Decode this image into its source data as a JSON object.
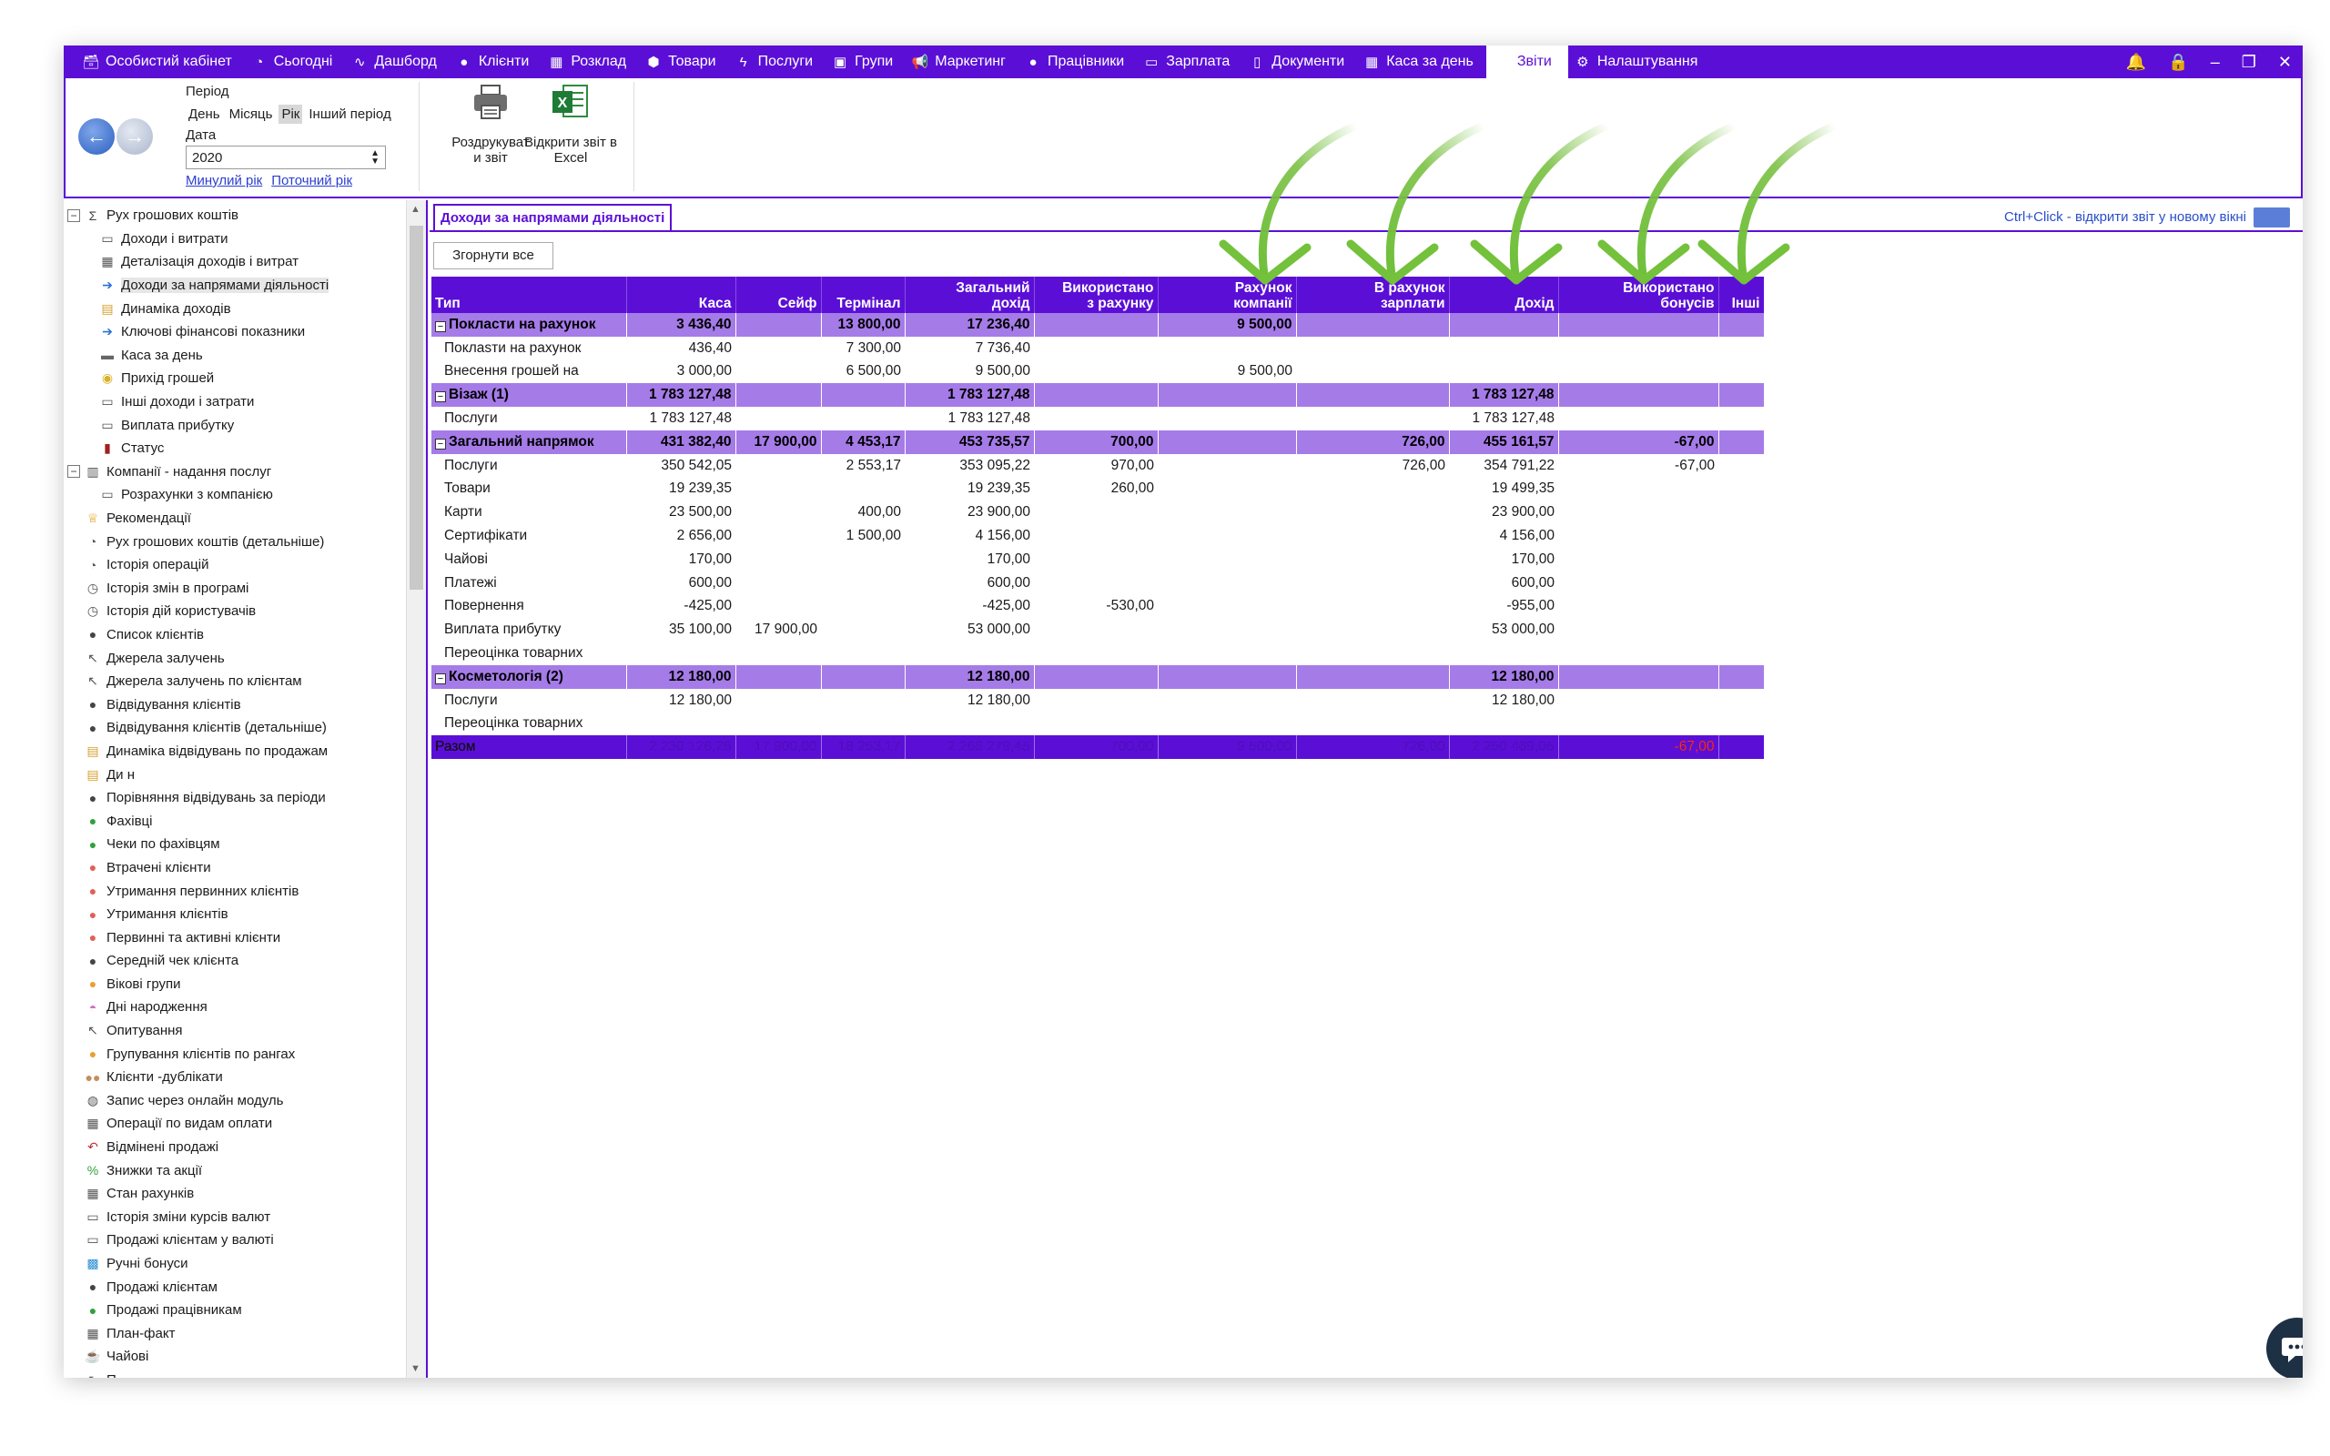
{
  "nav": {
    "items": [
      {
        "label": "Особистий кабінет",
        "icon": "cabinet-icon"
      },
      {
        "label": "Сьогодні",
        "icon": "clock-icon"
      },
      {
        "label": "Дашборд",
        "icon": "pulse-icon"
      },
      {
        "label": "Клієнти",
        "icon": "user-icon"
      },
      {
        "label": "Розклад",
        "icon": "calendar-icon"
      },
      {
        "label": "Товари",
        "icon": "box-icon"
      },
      {
        "label": "Послуги",
        "icon": "lightning-icon"
      },
      {
        "label": "Групи",
        "icon": "group-icon"
      },
      {
        "label": "Маркетинг",
        "icon": "megaphone-icon"
      },
      {
        "label": "Працівники",
        "icon": "worker-icon"
      },
      {
        "label": "Зарплата",
        "icon": "money-icon"
      },
      {
        "label": "Документи",
        "icon": "document-icon"
      },
      {
        "label": "Каса за день",
        "icon": "calculator-icon"
      },
      {
        "label": "Звіти",
        "icon": ""
      },
      {
        "label": "Налаштування",
        "icon": "gear-icon"
      }
    ],
    "active_index": 13
  },
  "ribbon": {
    "period_label": "Період",
    "period_tabs": [
      "День",
      "Місяць",
      "Рік",
      "Інший період"
    ],
    "period_selected": "Рік",
    "date_label": "Дата",
    "year_value": "2020",
    "prev_year_link": "Минулий рік",
    "current_year_link": "Поточний рік",
    "print_label": "Роздрукуват\nи звіт",
    "excel_label": "Відкрити звіт в\nExcel"
  },
  "sidebar": {
    "items": [
      {
        "label": "Рух грошових коштів",
        "level": 0,
        "expander": "⊟",
        "icon": "sigma-icon"
      },
      {
        "label": "Доходи і витрати",
        "level": 1,
        "icon": "money-icon"
      },
      {
        "label": "Деталізація доходів і витрат",
        "level": 1,
        "icon": "calculator-icon"
      },
      {
        "label": "Доходи за напрямами діяльності",
        "level": 1,
        "icon": "arrow-right-icon",
        "selected": true
      },
      {
        "label": "Динаміка доходів",
        "level": 1,
        "icon": "table-icon"
      },
      {
        "label": "Ключові фінансові показники",
        "level": 1,
        "icon": "arrow-right-icon"
      },
      {
        "label": "Каса за день",
        "level": 1,
        "icon": "cash-icon"
      },
      {
        "label": "Прихід грошей",
        "level": 1,
        "icon": "coins-icon"
      },
      {
        "label": "Інші доходи і затрати",
        "level": 1,
        "icon": "money-icon"
      },
      {
        "label": "Виплата прибутку",
        "level": 1,
        "icon": "money-icon"
      },
      {
        "label": "Статус",
        "level": 1,
        "icon": "flag-icon"
      },
      {
        "label": "Компанії - надання послуг",
        "level": 0,
        "expander": "⊟",
        "icon": "building-icon"
      },
      {
        "label": "Розрахунки з компанією",
        "level": 1,
        "icon": "money-icon"
      },
      {
        "label": "Рекомендації",
        "level": 0,
        "icon": "trophy-icon"
      },
      {
        "label": "Рух грошових коштів (детальніше)",
        "level": 0,
        "icon": "clock-icon"
      },
      {
        "label": "Історія операцій",
        "level": 0,
        "icon": "clock-icon"
      },
      {
        "label": "Історія змін в програмі",
        "level": 0,
        "icon": "history-icon"
      },
      {
        "label": "Історія дій користувачів",
        "level": 0,
        "icon": "history-icon"
      },
      {
        "label": "Список клієнтів",
        "level": 0,
        "icon": "user-icon"
      },
      {
        "label": "Джерела залучень",
        "level": 0,
        "icon": "cursor-icon"
      },
      {
        "label": "Джерела залучень по клієнтам",
        "level": 0,
        "icon": "cursor-icon"
      },
      {
        "label": "Відвідування клієнтів",
        "level": 0,
        "icon": "user-icon"
      },
      {
        "label": "Відвідування клієнтів (детальніше)",
        "level": 0,
        "icon": "user-icon"
      },
      {
        "label": "Динаміка відвідувань по продажам",
        "level": 0,
        "icon": "table-icon"
      },
      {
        "label": "Ди                              н",
        "level": 0,
        "icon": "table-icon"
      },
      {
        "label": "Порівняння відвідувань за періоди",
        "level": 0,
        "icon": "user-icon"
      },
      {
        "label": "Фахівці",
        "level": 0,
        "icon": "user-green-icon"
      },
      {
        "label": "Чеки по фахівцям",
        "level": 0,
        "icon": "user-green-icon"
      },
      {
        "label": "Втрачені клієнти",
        "level": 0,
        "icon": "user-red-icon"
      },
      {
        "label": "Утримання первинних клієнтів",
        "level": 0,
        "icon": "user-red-icon"
      },
      {
        "label": "Утримання клієнтів",
        "level": 0,
        "icon": "user-red-icon"
      },
      {
        "label": "Первинні та активні клієнти",
        "level": 0,
        "icon": "user-red-icon"
      },
      {
        "label": "Середній чек клієнта",
        "level": 0,
        "icon": "user-icon"
      },
      {
        "label": "Вікові групи",
        "level": 0,
        "icon": "user-orange-icon"
      },
      {
        "label": "Дні народження",
        "level": 0,
        "icon": "cake-icon"
      },
      {
        "label": "Опитування",
        "level": 0,
        "icon": "cursor-icon"
      },
      {
        "label": "Групування клієнтів по рангах",
        "level": 0,
        "icon": "user-orange-icon"
      },
      {
        "label": "Клієнти -дублікати",
        "level": 0,
        "icon": "users-icon"
      },
      {
        "label": "Запис через онлайн модуль",
        "level": 0,
        "icon": "globe-icon"
      },
      {
        "label": "Операції по видам оплати",
        "level": 0,
        "icon": "calculator-icon"
      },
      {
        "label": "Відмінені продажі",
        "level": 0,
        "icon": "undo-icon"
      },
      {
        "label": "Знижки та акції",
        "level": 0,
        "icon": "percent-icon"
      },
      {
        "label": "Стан рахунків",
        "level": 0,
        "icon": "calculator-icon"
      },
      {
        "label": "Історія зміни курсів валют",
        "level": 0,
        "icon": "money-icon"
      },
      {
        "label": "Продажі клієнтам у валюті",
        "level": 0,
        "icon": "money-icon"
      },
      {
        "label": "Ручні бонуси",
        "level": 0,
        "icon": "bonus-icon"
      },
      {
        "label": "Продажі клієнтам",
        "level": 0,
        "icon": "user-icon"
      },
      {
        "label": "Продажі працівникам",
        "level": 0,
        "icon": "user-green-icon"
      },
      {
        "label": "План-факт",
        "level": 0,
        "icon": "calculator-icon"
      },
      {
        "label": "Чайові",
        "level": 0,
        "icon": "tip-icon"
      },
      {
        "label": "П     ...",
        "level": 0,
        "icon": "cursor-icon"
      }
    ]
  },
  "main": {
    "tab_label": "Доходи за напрямами діяльності",
    "ctrl_hint": "Ctrl+Click - відкрити звіт у новому вікні",
    "collapse_label": "Згорнути все",
    "columns": [
      "Тип",
      "Каса",
      "Сейф",
      "Термінал",
      "Загальний\nдохід",
      "Використано\nз рахунку",
      "Рахунок\nкомпанії",
      "В рахунок\nзарплати",
      "Дохід",
      "Використано\nбонусів",
      "Інші"
    ],
    "rows": [
      {
        "kind": "grp",
        "cells": [
          "Покласти на рахунок",
          "3 436,40",
          "",
          "13 800,00",
          "17 236,40",
          "",
          "9 500,00",
          "",
          "",
          "",
          ""
        ]
      },
      {
        "kind": "sub",
        "cells": [
          "Поклasти на рахунок",
          "436,40",
          "",
          "7 300,00",
          "7 736,40",
          "",
          "",
          "",
          "",
          "",
          ""
        ]
      },
      {
        "kind": "sub",
        "cells": [
          "Внесення грошей на",
          "3 000,00",
          "",
          "6 500,00",
          "9 500,00",
          "",
          "9 500,00",
          "",
          "",
          "",
          ""
        ]
      },
      {
        "kind": "grp",
        "cells": [
          "Візаж (1)",
          "1 783 127,48",
          "",
          "",
          "1 783 127,48",
          "",
          "",
          "",
          "1 783 127,48",
          "",
          ""
        ]
      },
      {
        "kind": "sub",
        "cells": [
          "Послуги",
          "1 783 127,48",
          "",
          "",
          "1 783 127,48",
          "",
          "",
          "",
          "1 783 127,48",
          "",
          ""
        ]
      },
      {
        "kind": "grp",
        "cells": [
          "Загальний напрямок",
          "431 382,40",
          "17 900,00",
          "4 453,17",
          "453 735,57",
          "700,00",
          "",
          "726,00",
          "455 161,57",
          "-67,00",
          ""
        ]
      },
      {
        "kind": "sub",
        "cells": [
          "Послуги",
          "350 542,05",
          "",
          "2 553,17",
          "353 095,22",
          "970,00",
          "",
          "726,00",
          "354 791,22",
          "-67,00",
          ""
        ]
      },
      {
        "kind": "sub",
        "cells": [
          "Товари",
          "19 239,35",
          "",
          "",
          "19 239,35",
          "260,00",
          "",
          "",
          "19 499,35",
          "",
          ""
        ]
      },
      {
        "kind": "sub",
        "cells": [
          "Карти",
          "23 500,00",
          "",
          "400,00",
          "23 900,00",
          "",
          "",
          "",
          "23 900,00",
          "",
          ""
        ]
      },
      {
        "kind": "sub",
        "cells": [
          "Сертифікати",
          "2 656,00",
          "",
          "1 500,00",
          "4 156,00",
          "",
          "",
          "",
          "4 156,00",
          "",
          ""
        ]
      },
      {
        "kind": "sub",
        "cells": [
          "Чайові",
          "170,00",
          "",
          "",
          "170,00",
          "",
          "",
          "",
          "170,00",
          "",
          ""
        ]
      },
      {
        "kind": "sub",
        "cells": [
          "Платежі",
          "600,00",
          "",
          "",
          "600,00",
          "",
          "",
          "",
          "600,00",
          "",
          ""
        ]
      },
      {
        "kind": "sub",
        "cells": [
          "Повернення",
          "-425,00",
          "",
          "",
          "-425,00",
          "-530,00",
          "",
          "",
          "-955,00",
          "",
          ""
        ]
      },
      {
        "kind": "sub",
        "cells": [
          "Виплата прибутку",
          "35 100,00",
          "17 900,00",
          "",
          "53 000,00",
          "",
          "",
          "",
          "53 000,00",
          "",
          ""
        ]
      },
      {
        "kind": "sub",
        "cells": [
          "Переоцінка товарних",
          "",
          "",
          "",
          "",
          "",
          "",
          "",
          "",
          "",
          ""
        ]
      },
      {
        "kind": "grp",
        "cells": [
          "Косметологія (2)",
          "12 180,00",
          "",
          "",
          "12 180,00",
          "",
          "",
          "",
          "12 180,00",
          "",
          ""
        ]
      },
      {
        "kind": "sub",
        "cells": [
          "Послуги",
          "12 180,00",
          "",
          "",
          "12 180,00",
          "",
          "",
          "",
          "12 180,00",
          "",
          ""
        ]
      },
      {
        "kind": "sub",
        "cells": [
          "Переоцінка товарних",
          "",
          "",
          "",
          "",
          "",
          "",
          "",
          "",
          "",
          ""
        ]
      },
      {
        "kind": "total",
        "cells": [
          "Разом",
          "2 230 126,28",
          "17 900,00",
          "18 253,17",
          "2 266 279,45",
          "700,00",
          "9 500,00",
          "726,00",
          "2 250 469,05",
          "-67,00",
          ""
        ]
      }
    ]
  },
  "colors": {
    "accent": "#5b0fd6",
    "group_row": "#a57be8",
    "negative": "#e01818",
    "arrow": "#7ac143"
  }
}
